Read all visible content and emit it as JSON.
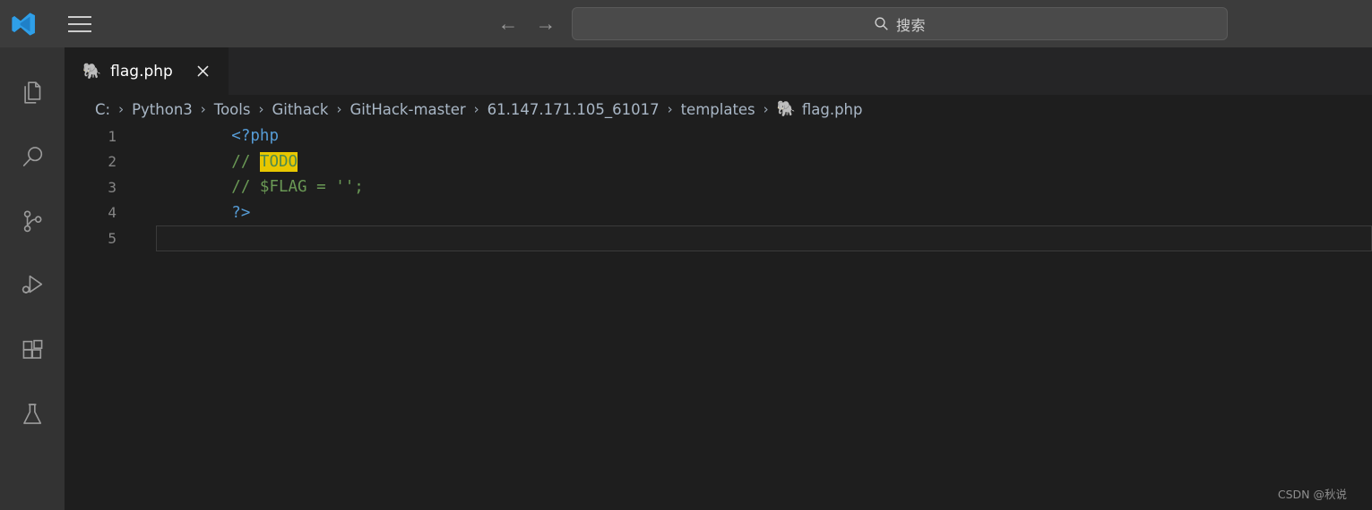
{
  "window": {
    "background": "#1e1e1e",
    "titlebar_background": "#3c3c3c",
    "activitybar_background": "#333333",
    "tabstrip_background": "#252526",
    "accent": "#0078d4"
  },
  "titlebar": {
    "logo_name": "vscode-logo",
    "menu_label": "☰",
    "back_label": "←",
    "forward_label": "→",
    "search": {
      "value": "",
      "placeholder": "搜索",
      "icon": "search-icon",
      "display_text": "搜索"
    }
  },
  "activitybar": {
    "items": [
      {
        "name": "explorer",
        "icon": "files-icon",
        "label": "Explorer"
      },
      {
        "name": "search",
        "icon": "search-icon",
        "label": "Search"
      },
      {
        "name": "source-control",
        "icon": "source-control-icon",
        "label": "Source Control"
      },
      {
        "name": "run-debug",
        "icon": "run-and-debug-icon",
        "label": "Run and Debug"
      },
      {
        "name": "extensions",
        "icon": "extensions-icon",
        "label": "Extensions"
      },
      {
        "name": "testing",
        "icon": "beaker-icon",
        "label": "Testing"
      }
    ]
  },
  "tabs": [
    {
      "label": "flag.php",
      "icon": "php-elephant-icon",
      "icon_glyph": "🐘",
      "active": true,
      "close_label": "✕"
    }
  ],
  "breadcrumb": {
    "separator": "›",
    "items": [
      {
        "label": "C:",
        "icon": ""
      },
      {
        "label": "Python3",
        "icon": ""
      },
      {
        "label": "Tools",
        "icon": ""
      },
      {
        "label": "Githack",
        "icon": ""
      },
      {
        "label": "GitHack-master",
        "icon": ""
      },
      {
        "label": "61.147.171.105_61017",
        "icon": ""
      },
      {
        "label": "templates",
        "icon": ""
      },
      {
        "label": "flag.php",
        "icon": "🐘"
      }
    ]
  },
  "editor": {
    "language": "php",
    "active_line": 5,
    "lines": [
      {
        "number": "1",
        "tokens": [
          {
            "text": "<?php",
            "style": "tok-blue"
          }
        ]
      },
      {
        "number": "2",
        "tokens": [
          {
            "text": "// ",
            "style": "tok-green"
          },
          {
            "text": "TODO",
            "style": "tok-todo"
          }
        ]
      },
      {
        "number": "3",
        "tokens": [
          {
            "text": "// $FLAG = '';",
            "style": "tok-green"
          }
        ]
      },
      {
        "number": "4",
        "tokens": [
          {
            "text": "?>",
            "style": "tok-blue"
          }
        ]
      },
      {
        "number": "5",
        "tokens": [
          {
            "text": "",
            "style": ""
          }
        ]
      }
    ]
  },
  "watermark": {
    "text": "CSDN @秋说"
  }
}
